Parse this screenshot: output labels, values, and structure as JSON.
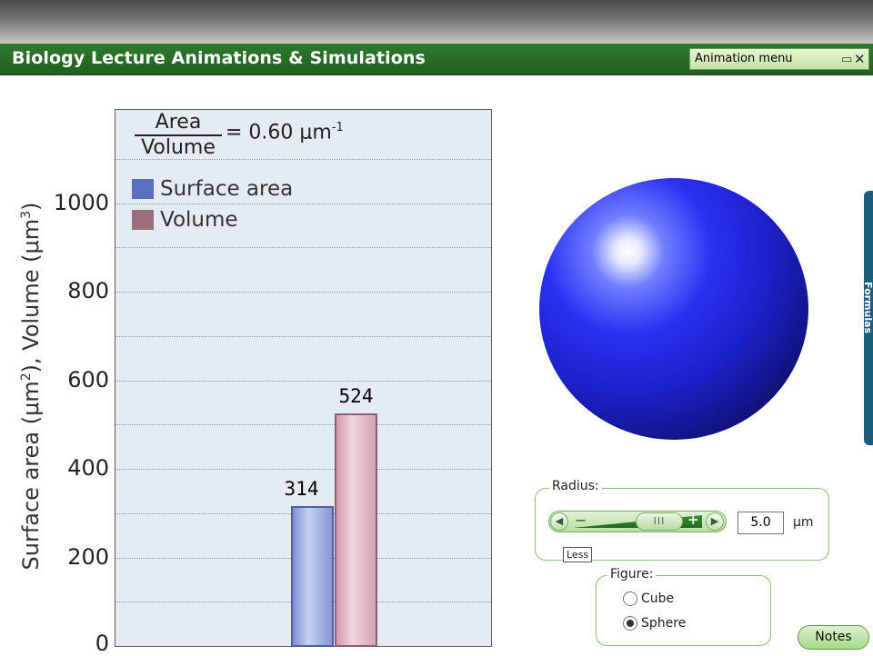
{
  "header": {
    "title": "Biology Lecture Animations & Simulations",
    "animation_menu": "Animation menu",
    "window_icon": "restore-icon",
    "close_icon": "close-icon"
  },
  "ratio": {
    "numerator": "Area",
    "denominator": "Volume",
    "equals": "= 0.60 μm",
    "exponent": "-1"
  },
  "chart_data": {
    "type": "bar",
    "categories": [
      "Surface area",
      "Volume"
    ],
    "values": [
      314,
      524
    ],
    "ylabel": "Surface area (μm2), Volume (μm3)",
    "ylabel_parts": [
      "Surface area (μm",
      "2",
      "), Volume (μm",
      "3",
      ")"
    ],
    "ylim": [
      0,
      1200
    ],
    "yticks": [
      0,
      200,
      400,
      600,
      800,
      1000
    ],
    "grid": true,
    "legend": [
      "Surface area",
      "Volume"
    ],
    "colors": [
      "#5b6fbf",
      "#9a6e7b"
    ],
    "data_labels": [
      "314",
      "524"
    ]
  },
  "radius": {
    "title": "Radius:",
    "value": "5.0",
    "unit": "μm",
    "tooltip": "Less",
    "minus": "−",
    "plus": "+"
  },
  "figure": {
    "title": "Figure:",
    "options": [
      "Cube",
      "Sphere"
    ],
    "selected": "Sphere"
  },
  "buttons": {
    "notes": "Notes",
    "formulas": "Formulas"
  }
}
